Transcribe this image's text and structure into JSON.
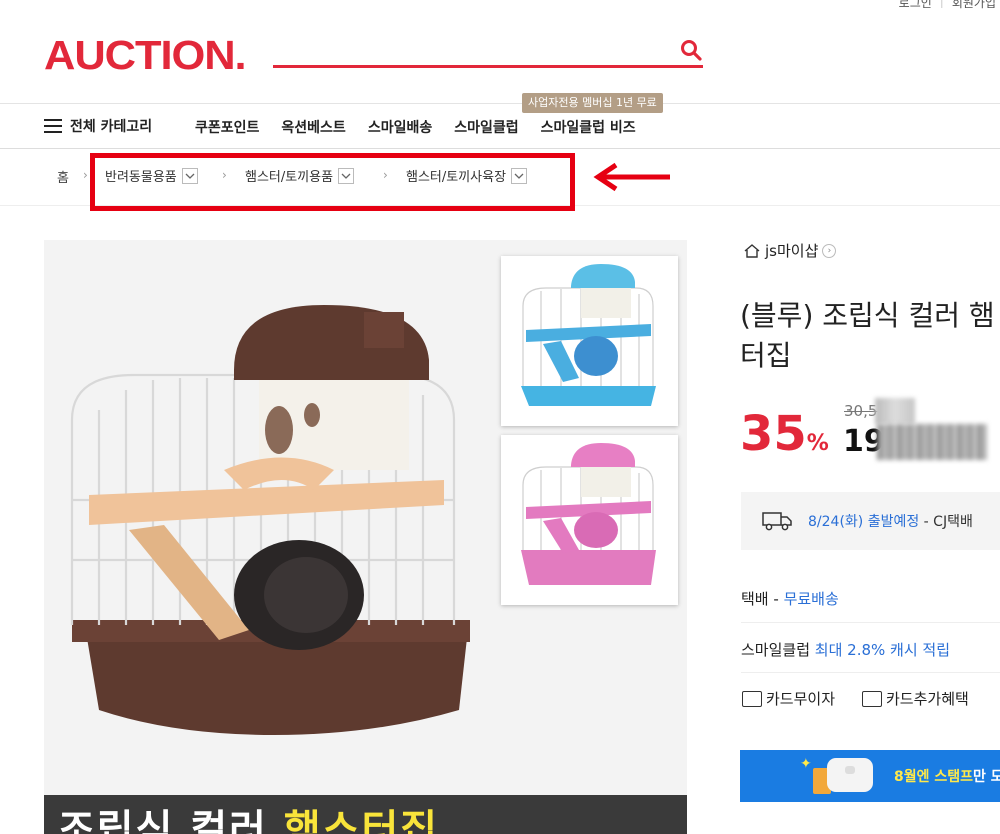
{
  "util": {
    "login": "로그인",
    "signup": "회원가입"
  },
  "header": {
    "logo": "AUCTION.",
    "search_placeholder": ""
  },
  "nav": {
    "all_categories": "전체 카테고리",
    "items": [
      "쿠폰포인트",
      "옥션베스트",
      "스마일배송",
      "스마일클럽",
      "스마일클럽 비즈"
    ],
    "promo_badge": "사업자전용 멤버십 1년 무료"
  },
  "breadcrumb": {
    "home": "홈",
    "levels": [
      "반려동물용품",
      "햄스터/토끼용품",
      "햄스터/토끼사육장"
    ]
  },
  "gallery": {
    "banner_white": "조립식 컬러",
    "banner_yellow": "햄스터집"
  },
  "product": {
    "seller": "js마이샵",
    "title_line1": "(블루) 조립식 컬러 햄",
    "title_line2": "터집",
    "discount_value": "35",
    "discount_unit": "%",
    "original_price": "30,5",
    "sale_price": "19"
  },
  "shipping": {
    "date": "8/24(화) 출발예정",
    "carrier": " - CJ택배"
  },
  "delivery": {
    "label": "택배 - ",
    "value": "무료배송"
  },
  "smileclub": {
    "label": "스마일클럽 ",
    "value": "최대 2.8% 캐시 적립"
  },
  "benefits": {
    "card_installment": "카드무이자",
    "card_extra": "카드추가혜택"
  },
  "stamp_banner": {
    "highlight": "8월엔 스탬프",
    "rest": "만 모"
  },
  "colors": {
    "brand_red": "#e2283a",
    "link_blue": "#2a6fd6",
    "highlight_red": "#e60012"
  }
}
